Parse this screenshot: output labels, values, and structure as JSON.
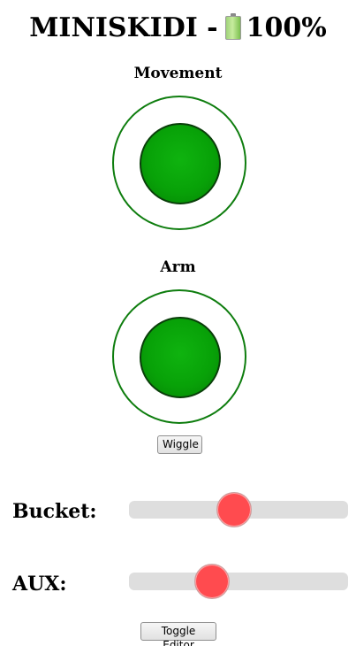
{
  "header": {
    "title": "MINISKIDI -",
    "battery_icon": "battery-icon",
    "battery_level": "100%"
  },
  "movement": {
    "label": "Movement",
    "x": 0,
    "y": 0
  },
  "arm": {
    "label": "Arm",
    "x": 0,
    "y": 0,
    "wiggle_label": "Wiggle"
  },
  "bucket": {
    "label": "Bucket:",
    "value_fraction": 0.48
  },
  "aux": {
    "label": "AUX:",
    "value_fraction": 0.38
  },
  "footer": {
    "toggle_editor_label": "Toggle Editor"
  },
  "colors": {
    "joystick_ring": "#0e7d0e",
    "joystick_knob": "#08a208",
    "slider_track": "#dedede",
    "slider_thumb": "#ff4b4f"
  }
}
